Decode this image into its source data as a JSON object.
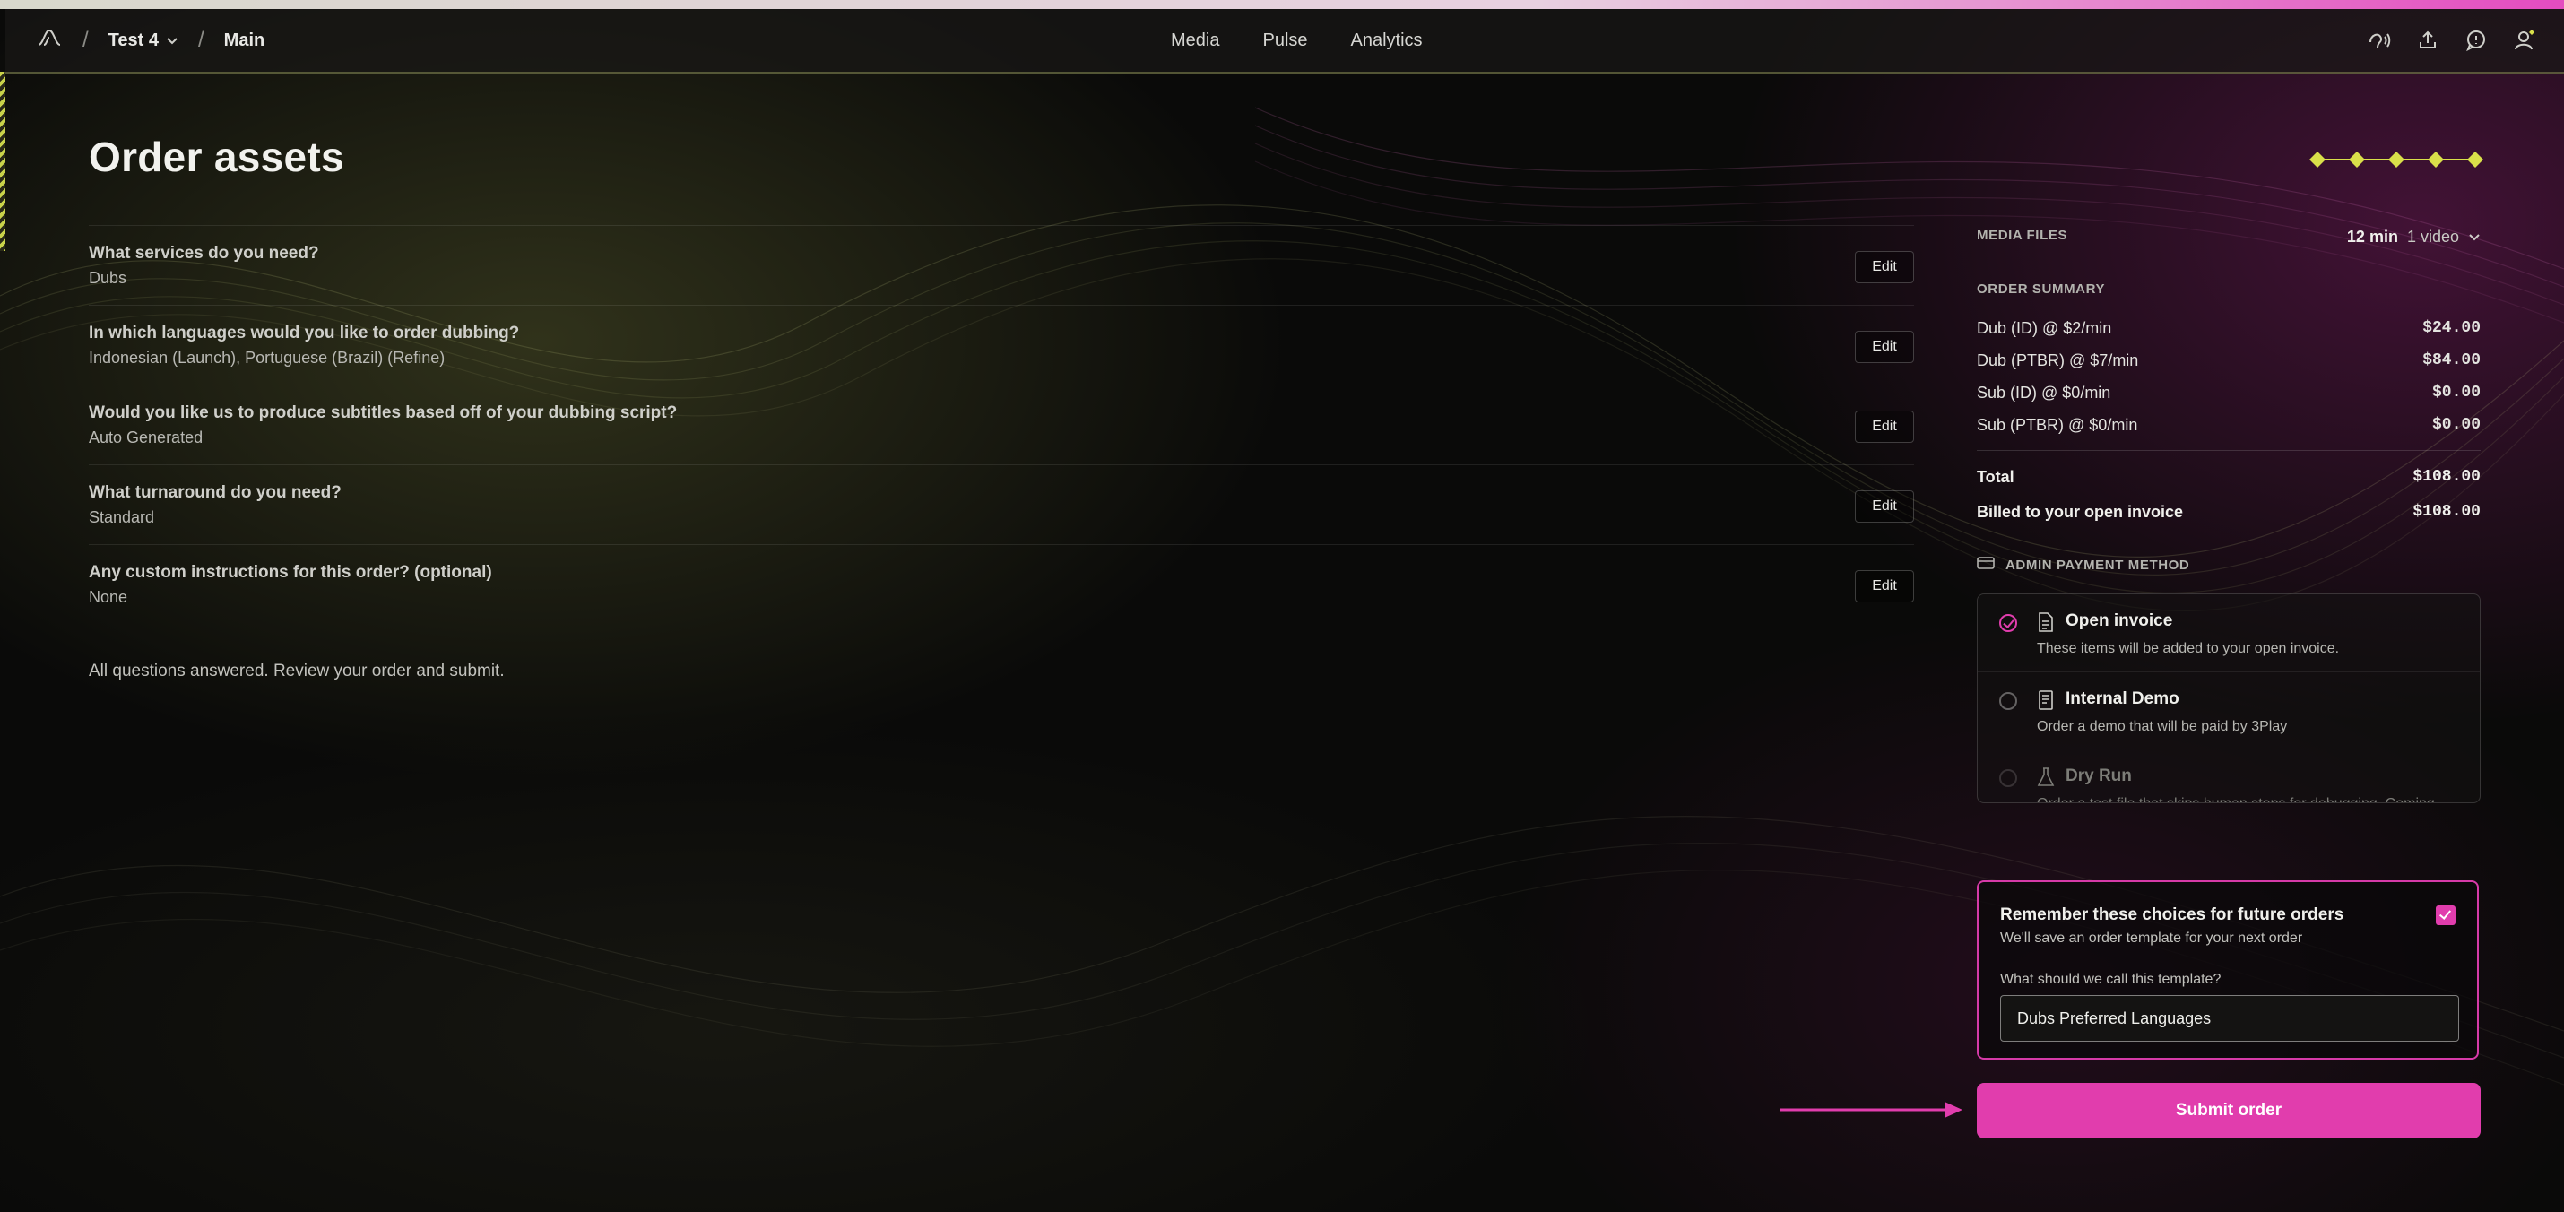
{
  "breadcrumb": {
    "project": "Test 4",
    "page": "Main"
  },
  "nav": [
    "Media",
    "Pulse",
    "Analytics"
  ],
  "toolbar_icons": [
    "support-icon",
    "upload-icon",
    "chat-icon",
    "account-icon"
  ],
  "page": {
    "title": "Order assets",
    "progress_steps": 5,
    "progress_color": "#d9e04a"
  },
  "questions": [
    {
      "question": "What services do you need?",
      "answer": "Dubs",
      "edit": "Edit"
    },
    {
      "question": "In which languages would you like to order dubbing?",
      "answer": "Indonesian (Launch), Portuguese (Brazil) (Refine)",
      "edit": "Edit"
    },
    {
      "question": "Would you like us to produce subtitles based off of your dubbing script?",
      "answer": "Auto Generated",
      "edit": "Edit"
    },
    {
      "question": "What turnaround do you need?",
      "answer": "Standard",
      "edit": "Edit"
    },
    {
      "question": "Any custom instructions for this order? (optional)",
      "answer": "None",
      "edit": "Edit"
    }
  ],
  "status_message": "All questions answered. Review your order and submit.",
  "summary": {
    "media_files_label": "MEDIA FILES",
    "media_duration": "12 min",
    "media_count": "1 video",
    "order_summary_label": "ORDER SUMMARY",
    "lines": [
      {
        "label": "Dub (ID) @ $2/min",
        "amount": "$24.00"
      },
      {
        "label": "Dub (PTBR) @ $7/min",
        "amount": "$84.00"
      },
      {
        "label": "Sub (ID) @ $0/min",
        "amount": "$0.00"
      },
      {
        "label": "Sub (PTBR) @ $0/min",
        "amount": "$0.00"
      }
    ],
    "total_label": "Total",
    "total": "$108.00",
    "billed_label": "Billed to your open invoice",
    "billed": "$108.00"
  },
  "payment": {
    "label": "ADMIN PAYMENT METHOD",
    "options": [
      {
        "title": "Open invoice",
        "desc": "These items will be added to your open invoice.",
        "selected": true,
        "disabled": false
      },
      {
        "title": "Internal Demo",
        "desc": "Order a demo that will be paid by 3Play",
        "selected": false,
        "disabled": false
      },
      {
        "title": "Dry Run",
        "desc": "Order a test file that skips human steps for debugging. Coming soon.",
        "selected": false,
        "disabled": true
      }
    ]
  },
  "remember": {
    "title": "Remember these choices for future orders",
    "subtitle": "We'll save an order template for your next order",
    "checked": true,
    "input_label": "What should we call this template?",
    "input_value": "Dubs Preferred Languages"
  },
  "submit_label": "Submit order",
  "colors": {
    "accent": "#e13dad",
    "progress": "#d9e04a"
  }
}
